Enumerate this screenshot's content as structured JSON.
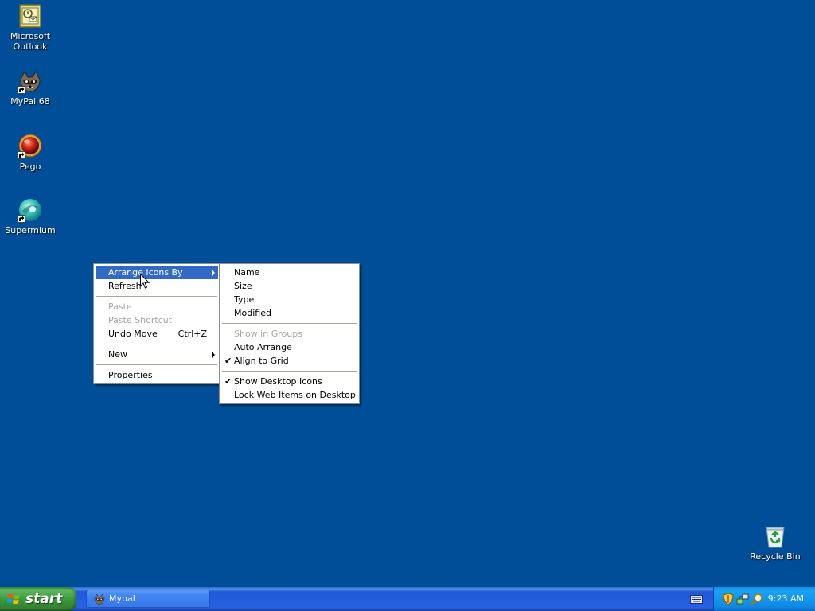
{
  "desktop": {
    "background_color": "#004e98",
    "icons": [
      {
        "label": "Microsoft Outlook",
        "icon": "outlook-icon"
      },
      {
        "label": "MyPal 68",
        "icon": "mypal-raccoon-icon"
      },
      {
        "label": "Pego",
        "icon": "pego-icon"
      },
      {
        "label": "Supermium",
        "icon": "supermium-icon"
      },
      {
        "label": "Recycle Bin",
        "icon": "recycle-bin-icon"
      }
    ]
  },
  "context_menu": {
    "items": [
      {
        "label": "Arrange Icons By",
        "submenu": true,
        "highlighted": true
      },
      {
        "label": "Refresh"
      },
      {
        "label": "Paste",
        "disabled": true
      },
      {
        "label": "Paste Shortcut",
        "disabled": true
      },
      {
        "label": "Undo Move",
        "shortcut": "Ctrl+Z"
      },
      {
        "label": "New",
        "submenu": true
      },
      {
        "label": "Properties"
      }
    ],
    "highlight_color": "#316ac5"
  },
  "arrange_submenu": {
    "items": [
      {
        "label": "Name"
      },
      {
        "label": "Size"
      },
      {
        "label": "Type"
      },
      {
        "label": "Modified"
      },
      {
        "label": "Show in Groups",
        "disabled": true
      },
      {
        "label": "Auto Arrange"
      },
      {
        "label": "Align to Grid",
        "checked": true
      },
      {
        "label": "Show Desktop Icons",
        "checked": true
      },
      {
        "label": "Lock Web Items on Desktop"
      }
    ],
    "check_glyph": "✔"
  },
  "taskbar": {
    "start_label": "start",
    "tasks": [
      {
        "label": "Mypal",
        "icon": "mypal-raccoon-icon"
      }
    ],
    "tray_icons": [
      "security-shield-icon",
      "network-icon",
      "search-icon"
    ],
    "clock": "9:23 AM"
  }
}
